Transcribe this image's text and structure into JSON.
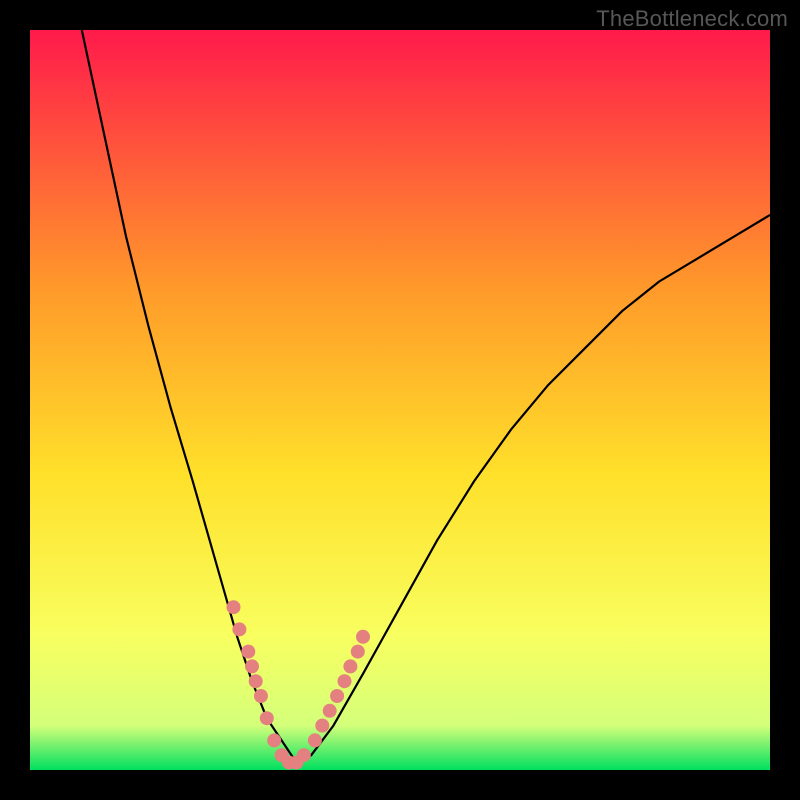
{
  "watermark": "TheBottleneck.com",
  "colors": {
    "background": "#000000",
    "curve": "#000000",
    "marker": "#e48080",
    "gradient_top": "#ff1a4b",
    "gradient_upper_mid": "#ff9a2a",
    "gradient_mid": "#ffe02a",
    "gradient_lower_mid": "#f8ff60",
    "gradient_above_green": "#d4ff7a",
    "gradient_bottom": "#00e060"
  },
  "chart_data": {
    "type": "line",
    "title": "",
    "xlabel": "",
    "ylabel": "",
    "xlim": [
      0,
      100
    ],
    "ylim": [
      0,
      100
    ],
    "series": [
      {
        "name": "bottleneck-curve",
        "x": [
          7,
          10,
          13,
          16,
          19,
          22,
          24,
          26,
          28,
          30,
          32,
          34,
          36,
          38,
          41,
          45,
          50,
          55,
          60,
          65,
          70,
          75,
          80,
          85,
          90,
          95,
          100
        ],
        "y": [
          100,
          86,
          72,
          60,
          49,
          39,
          32,
          25,
          18,
          12,
          7,
          4,
          1,
          2,
          6,
          13,
          22,
          31,
          39,
          46,
          52,
          57,
          62,
          66,
          69,
          72,
          75
        ]
      }
    ],
    "markers": {
      "name": "highlight-points",
      "x": [
        27.5,
        28.3,
        29.5,
        30.0,
        30.5,
        31.2,
        32.0,
        33.0,
        34.0,
        35.0,
        36.0,
        37.0,
        38.5,
        39.5,
        40.5,
        41.5,
        42.5,
        43.3,
        44.3,
        45.0
      ],
      "y": [
        22,
        19,
        16,
        14,
        12,
        10,
        7,
        4,
        2,
        1,
        1,
        2,
        4,
        6,
        8,
        10,
        12,
        14,
        16,
        18
      ]
    }
  }
}
